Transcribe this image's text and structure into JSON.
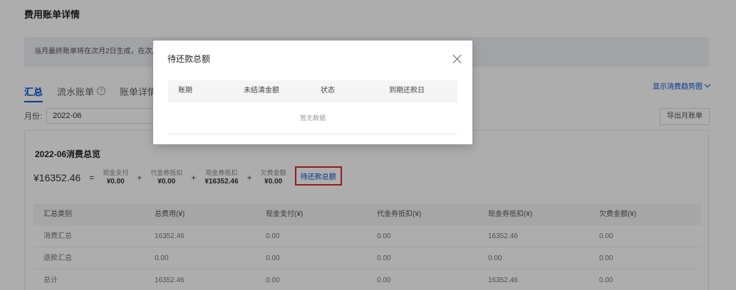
{
  "page": {
    "title": "费用账单详情",
    "notice": "当月最终账单将在次月2日生成，在次月3"
  },
  "tabs": [
    {
      "label": "汇总"
    },
    {
      "label": "流水账单"
    },
    {
      "label": "账单详情"
    }
  ],
  "trend_link": "显示消费趋势图",
  "filter": {
    "label": "月份:",
    "value": "2022-06"
  },
  "export_button": "导出月账单",
  "summary": {
    "title": "2022-06消费总览",
    "total": "¥16352.46",
    "equals": "=",
    "plus": "+",
    "terms": [
      {
        "label": "现金支付",
        "value": "¥0.00"
      },
      {
        "label": "代金券抵扣",
        "value": "¥0.00"
      },
      {
        "label": "现金券抵扣",
        "value": "¥16352.46"
      },
      {
        "label": "欠费金额",
        "value": "¥0.00"
      }
    ],
    "pending_link": "待还款总额"
  },
  "table": {
    "columns": [
      "汇总类别",
      "总费用(¥)",
      "现金支付(¥)",
      "代金券抵扣(¥)",
      "现金券抵扣(¥)",
      "欠费金额(¥)"
    ],
    "rows": [
      [
        "消费汇总",
        "16352.46",
        "0.00",
        "0.00",
        "16352.46",
        "0.00"
      ],
      [
        "退款汇总",
        "0.00",
        "0.00",
        "0.00",
        "0.00",
        "0.00"
      ],
      [
        "总计",
        "16352.46",
        "0.00",
        "0.00",
        "16352.46",
        "0.00"
      ]
    ]
  },
  "modal": {
    "title": "待还款总额",
    "columns": [
      "账期",
      "未结清金额",
      "状态",
      "到期还款日"
    ],
    "empty_text": "暂无数据"
  },
  "colors": {
    "accent": "#0052d9",
    "highlight_border": "#e0252b"
  }
}
